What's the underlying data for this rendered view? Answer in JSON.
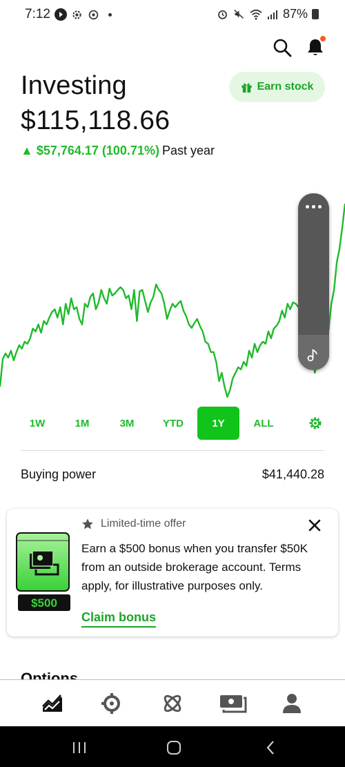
{
  "status_bar": {
    "time": "7:12",
    "battery": "87%"
  },
  "header": {
    "title": "Investing",
    "portfolio_value": "$115,118.66",
    "change_amount": "▲ $57,764.17 (100.71%)",
    "change_period": "Past year",
    "earn_button_label": "Earn stock"
  },
  "chart_data": {
    "type": "line",
    "period": "1Y",
    "color": "#1fba2b",
    "values": [
      560,
      520,
      512,
      518,
      508,
      522,
      510,
      500,
      505,
      495,
      498,
      490,
      476,
      480,
      470,
      482,
      465,
      470,
      460,
      452,
      448,
      460,
      445,
      470,
      440,
      455,
      432,
      448,
      445,
      462,
      470,
      440,
      445,
      430,
      425,
      448,
      438,
      420,
      432,
      440,
      418,
      428,
      425,
      420,
      416,
      420,
      432,
      428,
      448,
      420,
      465,
      422,
      420,
      436,
      452,
      438,
      430,
      412,
      420,
      425,
      440,
      462,
      450,
      440,
      445,
      440,
      436,
      450,
      458,
      470,
      475,
      468,
      462,
      472,
      480,
      495,
      498,
      510,
      510,
      525,
      552,
      540,
      560,
      575,
      565,
      548,
      540,
      532,
      535,
      524,
      530,
      508,
      518,
      498,
      510,
      500,
      495,
      498,
      480,
      490,
      476,
      472,
      465,
      450,
      460,
      440,
      448,
      438,
      440,
      445,
      420,
      410,
      390,
      396,
      520,
      540,
      522,
      520,
      505,
      490,
      478,
      440,
      420,
      380,
      360,
      330,
      295
    ],
    "y_range": [
      290,
      580
    ]
  },
  "side_panel": {
    "more_icon": "ellipsis-icon",
    "music_icon": "music-note-icon"
  },
  "ranges": [
    "1W",
    "1M",
    "3M",
    "YTD",
    "1Y",
    "ALL"
  ],
  "active_range": "1Y",
  "buying_power": {
    "label": "Buying power",
    "value": "$41,440.28"
  },
  "offer": {
    "tag": "Limited-time offer",
    "text": "Earn a $500 bonus when you transfer $50K from an outside brokerage account. Terms apply, for illustrative purposes only.",
    "cta": "Claim bonus",
    "badge": "$500"
  },
  "section_peek": "Options",
  "bottom_nav": {
    "items": [
      "investing-icon",
      "bitcoin-icon",
      "crypto-icon",
      "cash-icon",
      "account-icon"
    ]
  }
}
